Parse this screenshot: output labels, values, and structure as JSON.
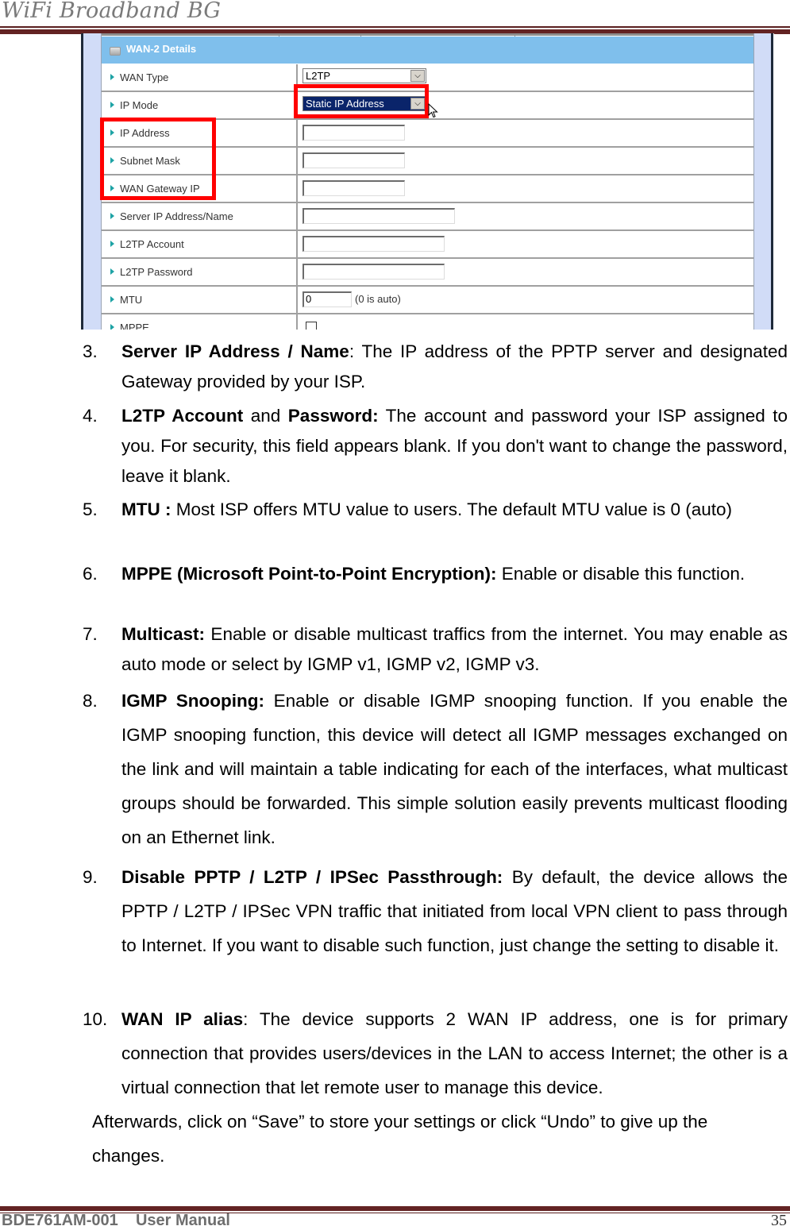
{
  "header": {
    "title": "WiFi Broadband BG"
  },
  "screenshot": {
    "panel_title": "WAN-2 Details",
    "rows": [
      {
        "label": "WAN Type",
        "control": "select",
        "value": "L2TP"
      },
      {
        "label": "IP Mode",
        "control": "select",
        "value": "Static IP Address"
      },
      {
        "label": "IP Address",
        "control": "text",
        "value": ""
      },
      {
        "label": "Subnet Mask",
        "control": "text",
        "value": ""
      },
      {
        "label": "WAN Gateway IP",
        "control": "text",
        "value": ""
      },
      {
        "label": "Server IP Address/Name",
        "control": "text",
        "value": ""
      },
      {
        "label": "L2TP Account",
        "control": "text",
        "value": ""
      },
      {
        "label": "L2TP Password",
        "control": "text",
        "value": ""
      },
      {
        "label": "MTU",
        "control": "text",
        "value": "0",
        "hint": "(0 is auto)"
      },
      {
        "label": "MPPE",
        "control": "checkbox",
        "checked": false
      }
    ],
    "dropdown_arrow": "⌵",
    "highlight_color": "#ff0000"
  },
  "items": [
    {
      "num": "3.",
      "term": "Server IP Address / Name",
      "sep": ":",
      "text": " The IP address of the PPTP server and designated Gateway provided by your ISP."
    },
    {
      "num": "4.",
      "term": "L2TP Account",
      "mid": " and ",
      "term2": "Password:",
      "text": " The account and password your ISP assigned to you. For security, this field appears blank. If you don't want to change the password, leave it blank."
    },
    {
      "num": "5.",
      "term": "MTU :",
      "text": " Most ISP offers MTU value to users. The default MTU value is 0 (auto)"
    },
    {
      "num": "6.",
      "term": "MPPE (Microsoft Point-to-Point Encryption):",
      "text": " Enable or disable this function."
    },
    {
      "num": "7.",
      "term": "Multicast:",
      "text": " Enable or disable multicast traffics from the internet. You may enable as auto mode or select by IGMP v1, IGMP v2, IGMP v3."
    },
    {
      "num": "8.",
      "term": "IGMP Snooping:",
      "text": " Enable or disable IGMP snooping function. If you enable the IGMP snooping function, this device will detect all IGMP messages exchanged on the link and will maintain a table indicating for each of the interfaces, what multicast groups should be forwarded. This simple solution easily prevents multicast flooding on an Ethernet link."
    },
    {
      "num": "9.",
      "term": "Disable PPTP / L2TP / IPSec Passthrough:",
      "text": " By default, the device allows the PPTP / L2TP / IPSec VPN traffic that initiated from local VPN client to pass through to Internet. If you want to disable such function, just change the setting to disable it."
    },
    {
      "num": "10.",
      "term": "WAN IP alias",
      "sep": ":",
      "text": " The device supports 2 WAN IP address, one is for primary connection that provides users/devices in the LAN to access Internet; the other is a virtual connection that let remote user to manage this device."
    }
  ],
  "afterwards": "Afterwards, click on “Save” to store your settings or click “Undo” to give up the changes.",
  "footer": {
    "doc_id": "BDE761AM-001    User Manual",
    "page": "35"
  },
  "colors": {
    "rule": "#632323",
    "panel_header": "#7fbfec",
    "side_bar": "#d1dcf7",
    "bullet_arrow": "#1ea3a5"
  }
}
